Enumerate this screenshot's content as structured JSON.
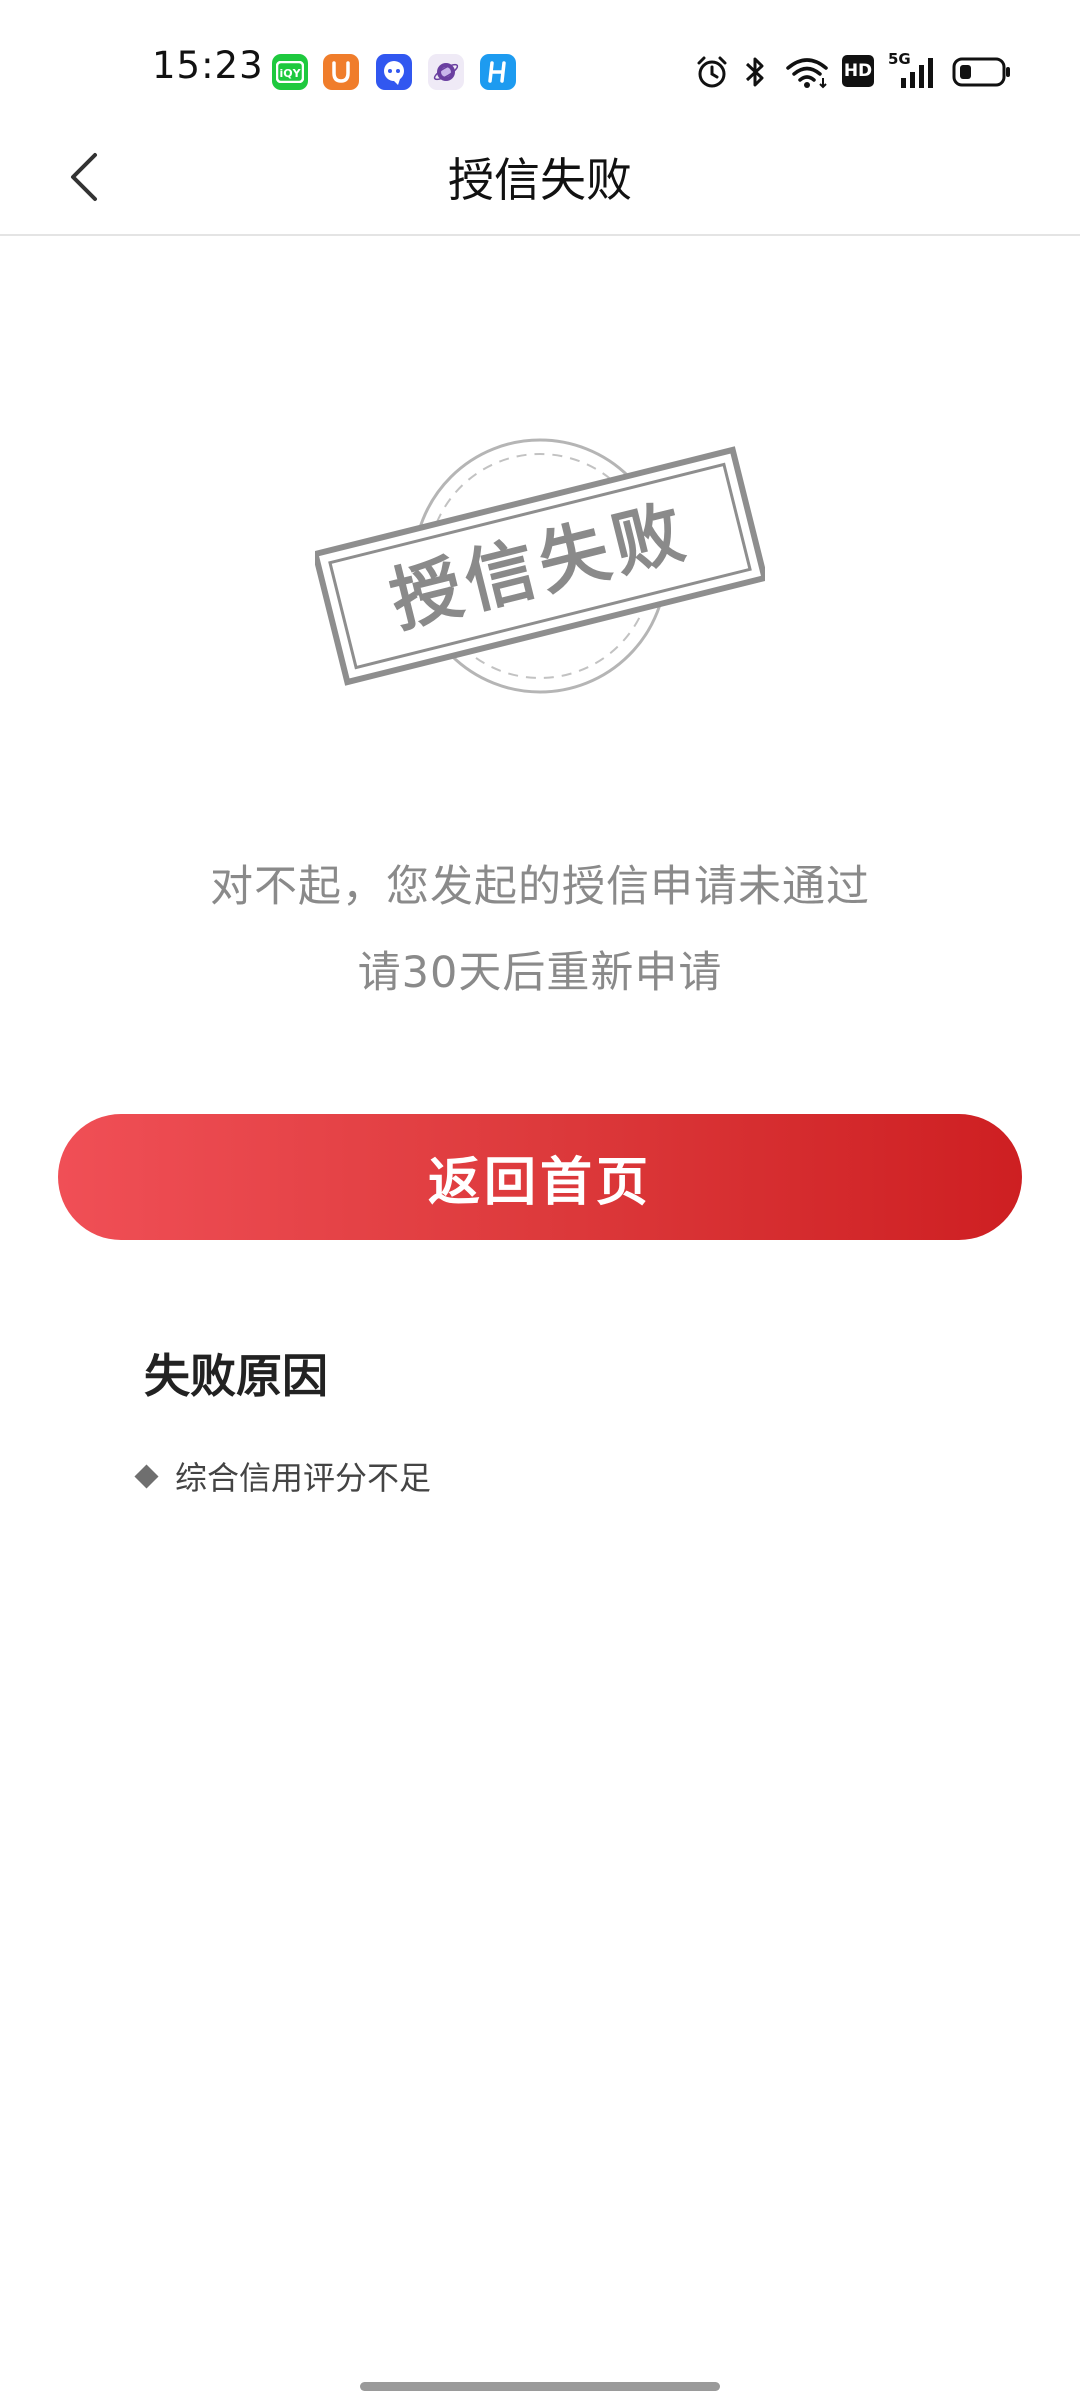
{
  "status_bar": {
    "time": "15:23",
    "apps": [
      {
        "name": "iqiyi-icon",
        "color": "#1ec93e",
        "glyph": "爱"
      },
      {
        "name": "uc-browser-icon",
        "color": "#f07d2b",
        "glyph": "U"
      },
      {
        "name": "chat-app-icon",
        "color": "#3157f0",
        "glyph": "Q"
      },
      {
        "name": "orbit-app-icon",
        "color": "#e9e4f4",
        "glyph": "◉"
      },
      {
        "name": "h-app-icon",
        "color": "#1d9bf0",
        "glyph": "H"
      }
    ],
    "network_label": "5G",
    "hd_label": "HD"
  },
  "nav": {
    "title": "授信失败"
  },
  "stamp": {
    "text": "授信失败"
  },
  "message": {
    "line1": "对不起，您发起的授信申请未通过",
    "line2": "请30天后重新申请"
  },
  "button": {
    "label": "返回首页"
  },
  "reasons": {
    "title": "失败原因",
    "items": [
      "综合信用评分不足"
    ]
  }
}
